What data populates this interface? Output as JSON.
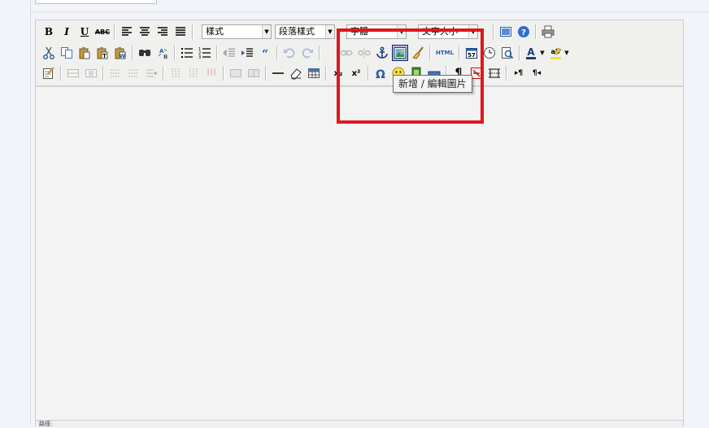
{
  "toolbar": {
    "text_buttons": {
      "bold": "B",
      "italic": "I",
      "underline": "U",
      "strikethrough": "ABC",
      "subscript": "x₂",
      "superscript": "x²",
      "html": "HTML",
      "pilcrow": "¶"
    },
    "selects": {
      "styles": "樣式",
      "format": "段落樣式",
      "font": "字體",
      "size": "文字大小"
    },
    "icons": [
      "bold-icon",
      "italic-icon",
      "underline-icon",
      "strikethrough-icon",
      "align-left-icon",
      "align-center-icon",
      "align-right-icon",
      "align-justify-icon",
      "cut-icon",
      "copy-icon",
      "paste-icon",
      "paste-text-icon",
      "paste-word-icon",
      "find-icon",
      "replace-icon",
      "bullet-list-icon",
      "numbered-list-icon",
      "outdent-icon",
      "indent-icon",
      "blockquote-icon",
      "undo-icon",
      "redo-icon",
      "link-icon",
      "unlink-icon",
      "anchor-icon",
      "image-icon",
      "cleanup-icon",
      "html-source-icon",
      "insert-date-icon",
      "insert-time-icon",
      "preview-icon",
      "forecolor-icon",
      "backcolor-icon",
      "fullscreen-icon",
      "help-icon",
      "print-icon",
      "table-icon",
      "horizontal-rule-icon",
      "remove-format-icon",
      "visual-aid-icon",
      "subscript-icon",
      "superscript-icon",
      "special-char-icon",
      "emoticon-icon",
      "media-icon",
      "advhr-icon",
      "show-blocks-icon",
      "page-break-icon",
      "ltr-icon",
      "rtl-icon"
    ]
  },
  "tooltip": {
    "text": "新增 / 編輯圖片"
  },
  "editor": {
    "content": ""
  },
  "status": {
    "path": "路徑:"
  },
  "colors": {
    "highlight": "#e1161c",
    "toolbar_bg": "#f0f0ee",
    "page_bg": "#f2f4f9",
    "active_button_bg": "#b6bdd2"
  }
}
